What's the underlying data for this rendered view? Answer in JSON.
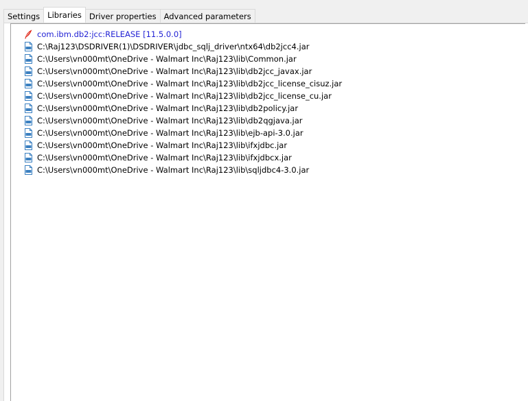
{
  "tabs": [
    {
      "label": "Settings",
      "active": false
    },
    {
      "label": "Libraries",
      "active": true
    },
    {
      "label": "Driver properties",
      "active": false
    },
    {
      "label": "Advanced parameters",
      "active": false
    }
  ],
  "libraries": {
    "driver_artifact": "com.ibm.db2:jcc:RELEASE [11.5.0.0]",
    "files": [
      "C:\\Raj123\\DSDRIVER(1)\\DSDRIVER\\jdbc_sqlj_driver\\ntx64\\db2jcc4.jar",
      "C:\\Users\\vn000mt\\OneDrive - Walmart Inc\\Raj123\\lib\\Common.jar",
      "C:\\Users\\vn000mt\\OneDrive - Walmart Inc\\Raj123\\lib\\db2jcc_javax.jar",
      "C:\\Users\\vn000mt\\OneDrive - Walmart Inc\\Raj123\\lib\\db2jcc_license_cisuz.jar",
      "C:\\Users\\vn000mt\\OneDrive - Walmart Inc\\Raj123\\lib\\db2jcc_license_cu.jar",
      "C:\\Users\\vn000mt\\OneDrive - Walmart Inc\\Raj123\\lib\\db2policy.jar",
      "C:\\Users\\vn000mt\\OneDrive - Walmart Inc\\Raj123\\lib\\db2qgjava.jar",
      "C:\\Users\\vn000mt\\OneDrive - Walmart Inc\\Raj123\\lib\\ejb-api-3.0.jar",
      "C:\\Users\\vn000mt\\OneDrive - Walmart Inc\\Raj123\\lib\\ifxjdbc.jar",
      "C:\\Users\\vn000mt\\OneDrive - Walmart Inc\\Raj123\\lib\\ifxjdbcx.jar",
      "C:\\Users\\vn000mt\\OneDrive - Walmart Inc\\Raj123\\lib\\sqljdbc4-3.0.jar"
    ]
  },
  "icons": {
    "driver": "maven-feather-icon",
    "file": "jar-file-icon"
  },
  "colors": {
    "driver_text": "#1f1fd4",
    "feather": "#e0291b",
    "jar_icon": "#3a7fc0"
  }
}
